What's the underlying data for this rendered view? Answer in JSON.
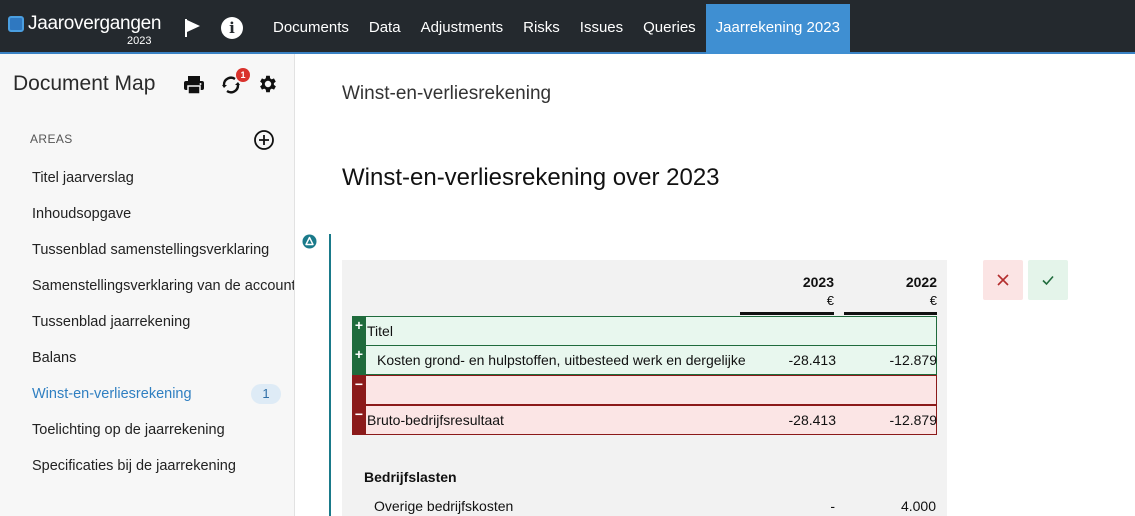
{
  "app": {
    "title": "Jaarovergangen",
    "year": "2023"
  },
  "nav": {
    "items": [
      {
        "label": "Documents"
      },
      {
        "label": "Data"
      },
      {
        "label": "Adjustments"
      },
      {
        "label": "Risks"
      },
      {
        "label": "Issues"
      },
      {
        "label": "Queries"
      },
      {
        "label": "Jaarrekening 2023",
        "active": true
      }
    ]
  },
  "sidebar": {
    "title": "Document Map",
    "sync_badge": "1",
    "areas_label": "AREAS",
    "items": [
      {
        "label": "Titel jaarverslag"
      },
      {
        "label": "Inhoudsopgave"
      },
      {
        "label": "Tussenblad samenstellingsverklaring"
      },
      {
        "label": "Samenstellingsverklaring van de accountant"
      },
      {
        "label": "Tussenblad jaarrekening"
      },
      {
        "label": "Balans"
      },
      {
        "label": "Winst-en-verliesrekening",
        "active": true,
        "badge": "1"
      },
      {
        "label": "Toelichting op de jaarrekening"
      },
      {
        "label": "Specificaties bij de jaarrekening"
      }
    ]
  },
  "main": {
    "heading": "Winst-en-verliesrekening",
    "doc_title": "Winst-en-verliesrekening over 2023",
    "table": {
      "col1": {
        "year": "2023",
        "currency": "€"
      },
      "col2": {
        "year": "2022",
        "currency": "€"
      },
      "rows": [
        {
          "marker": "+",
          "label": "Titel",
          "v1": "",
          "v2": ""
        },
        {
          "marker": "+",
          "label": "Kosten grond- en hulpstoffen, uitbesteed werk en dergelijke",
          "v1": "-28.413",
          "v2": "-12.879"
        },
        {
          "marker": "−",
          "label": "",
          "v1": "",
          "v2": ""
        },
        {
          "marker": "−",
          "label": "Bruto-bedrijfsresultaat",
          "v1": "-28.413",
          "v2": "-12.879"
        }
      ],
      "section_title": "Bedrijfslasten",
      "plain_row": {
        "label": "Overige bedrijfskosten",
        "v1": "-",
        "v2": "4.000"
      }
    }
  },
  "icons": {
    "flag": "flag-icon",
    "info": "info-icon",
    "print": "print-icon",
    "sync": "sync-icon",
    "settings": "gear-icon",
    "add": "add-circle-icon",
    "warning": "warning-triangle-icon",
    "reject": "close-icon",
    "accept": "check-icon"
  },
  "colors": {
    "topbar": "#24292e",
    "active_tab": "#3f8fd2",
    "accent": "#2f7fc1",
    "added": "#1f6b3c",
    "removed": "#8b1a1a",
    "badge_red": "#d9322c"
  }
}
